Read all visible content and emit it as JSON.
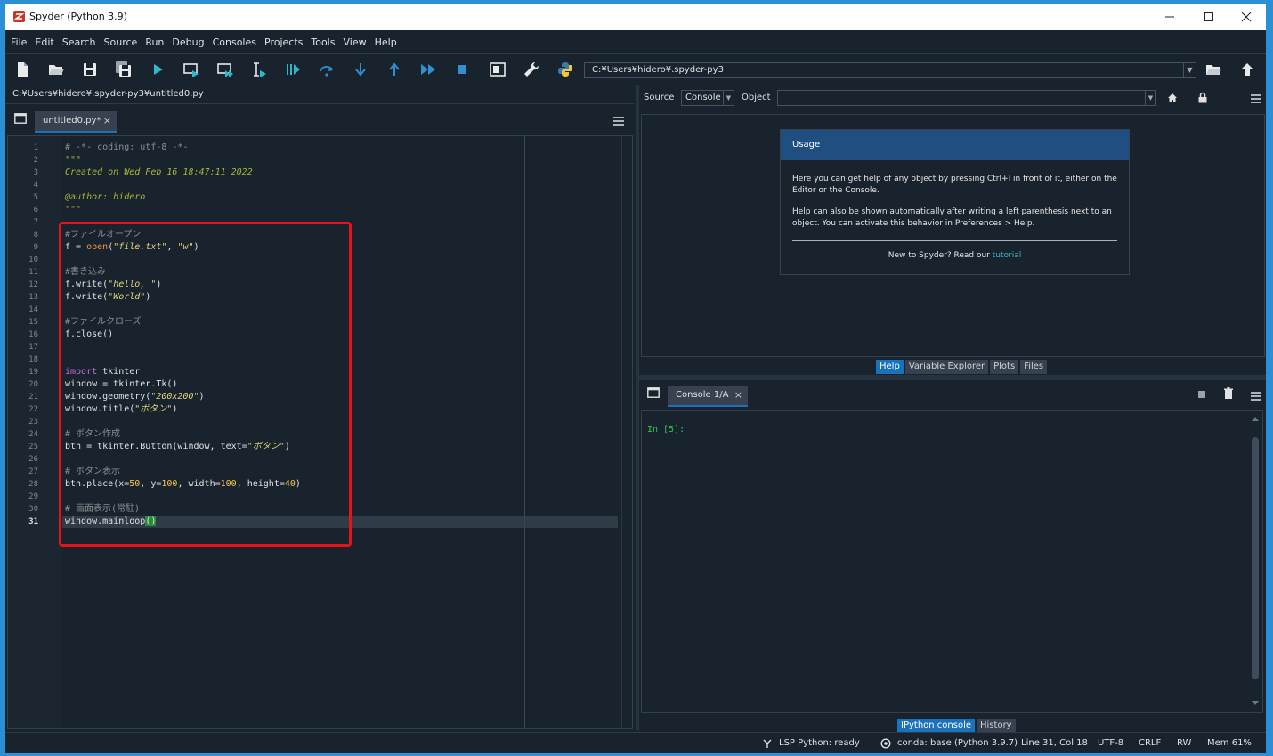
{
  "titlebar": {
    "title": "Spyder (Python 3.9)"
  },
  "menu": [
    "File",
    "Edit",
    "Search",
    "Source",
    "Run",
    "Debug",
    "Consoles",
    "Projects",
    "Tools",
    "View",
    "Help"
  ],
  "toolbar": {
    "working_dir": "C:¥Users¥hidero¥.spyder-py3"
  },
  "editor": {
    "path": "C:¥Users¥hidero¥.spyder-py3¥untitled0.py",
    "tab_label": "untitled0.py*",
    "current_line": 31,
    "line_numbers": [
      "1",
      "2",
      "3",
      "4",
      "5",
      "6",
      "7",
      "8",
      "9",
      "10",
      "11",
      "12",
      "13",
      "14",
      "15",
      "16",
      "17",
      "18",
      "19",
      "20",
      "21",
      "22",
      "23",
      "24",
      "25",
      "26",
      "27",
      "28",
      "29",
      "30",
      "31"
    ],
    "code": {
      "l1": "# -*- coding: utf-8 -*-",
      "l2": "\"\"\"",
      "l3": "Created on Wed Feb 16 18:47:11 2022",
      "l5": "@author: hidero",
      "l6": "\"\"\"",
      "l8": "#ファイルオープン",
      "l9a": "f = ",
      "l9b": "open",
      "l9c": "(",
      "l9d": "\"file.txt\"",
      "l9e": ", ",
      "l9f": "\"w\"",
      "l9g": ")",
      "l11": "#書き込み",
      "l12a": "f.write(",
      "l12b": "\"hello, \"",
      "l12c": ")",
      "l13a": "f.write(",
      "l13b": "\"World\"",
      "l13c": ")",
      "l15": "#ファイルクローズ",
      "l16": "f.close()",
      "l19a": "import",
      "l19b": " tkinter",
      "l20": "window = tkinter.Tk()",
      "l21a": "window.geometry(",
      "l21b": "\"200x200\"",
      "l21c": ")",
      "l22a": "window.title(",
      "l22b": "\"ボタン\"",
      "l22c": ")",
      "l24": "# ボタン作成",
      "l25a": "btn = tkinter.Button(window, text=",
      "l25b": "\"ボタン\"",
      "l25c": ")",
      "l27": "# ボタン表示",
      "l28a": "btn.place(x=",
      "l28b": "50",
      "l28c": ", y=",
      "l28d": "100",
      "l28e": ", width=",
      "l28f": "100",
      "l28g": ", height=",
      "l28h": "40",
      "l28i": ")",
      "l30": "# 画面表示(常駐)",
      "l31a": "window.mainloop",
      "l31b": "()"
    }
  },
  "help": {
    "source_label": "Source",
    "source_value": "Console",
    "object_label": "Object",
    "usage_title": "Usage",
    "usage_p1": "Here you can get help of any object by pressing Ctrl+I in front of it, either on the Editor or the Console.",
    "usage_p2": "Help can also be shown automatically after writing a left parenthesis next to an object. You can activate this behavior in Preferences > Help.",
    "usage_new": "New to Spyder? Read our ",
    "usage_link": "tutorial",
    "tabs": [
      "Help",
      "Variable Explorer",
      "Plots",
      "Files"
    ]
  },
  "console": {
    "tab_label": "Console 1/A",
    "prompt": "In [5]:",
    "tabs": [
      "IPython console",
      "History"
    ]
  },
  "status": {
    "lsp": "LSP Python: ready",
    "conda": "conda: base (Python 3.9.7)",
    "position": "Line 31, Col 18",
    "encoding": "UTF-8",
    "eol": "CRLF",
    "rw": "RW",
    "mem": "Mem 61%"
  },
  "colors": {
    "accent": "#1a72bb",
    "background": "#19232d",
    "highlight_box": "#e8121b",
    "prompt": "#2ec94a"
  }
}
